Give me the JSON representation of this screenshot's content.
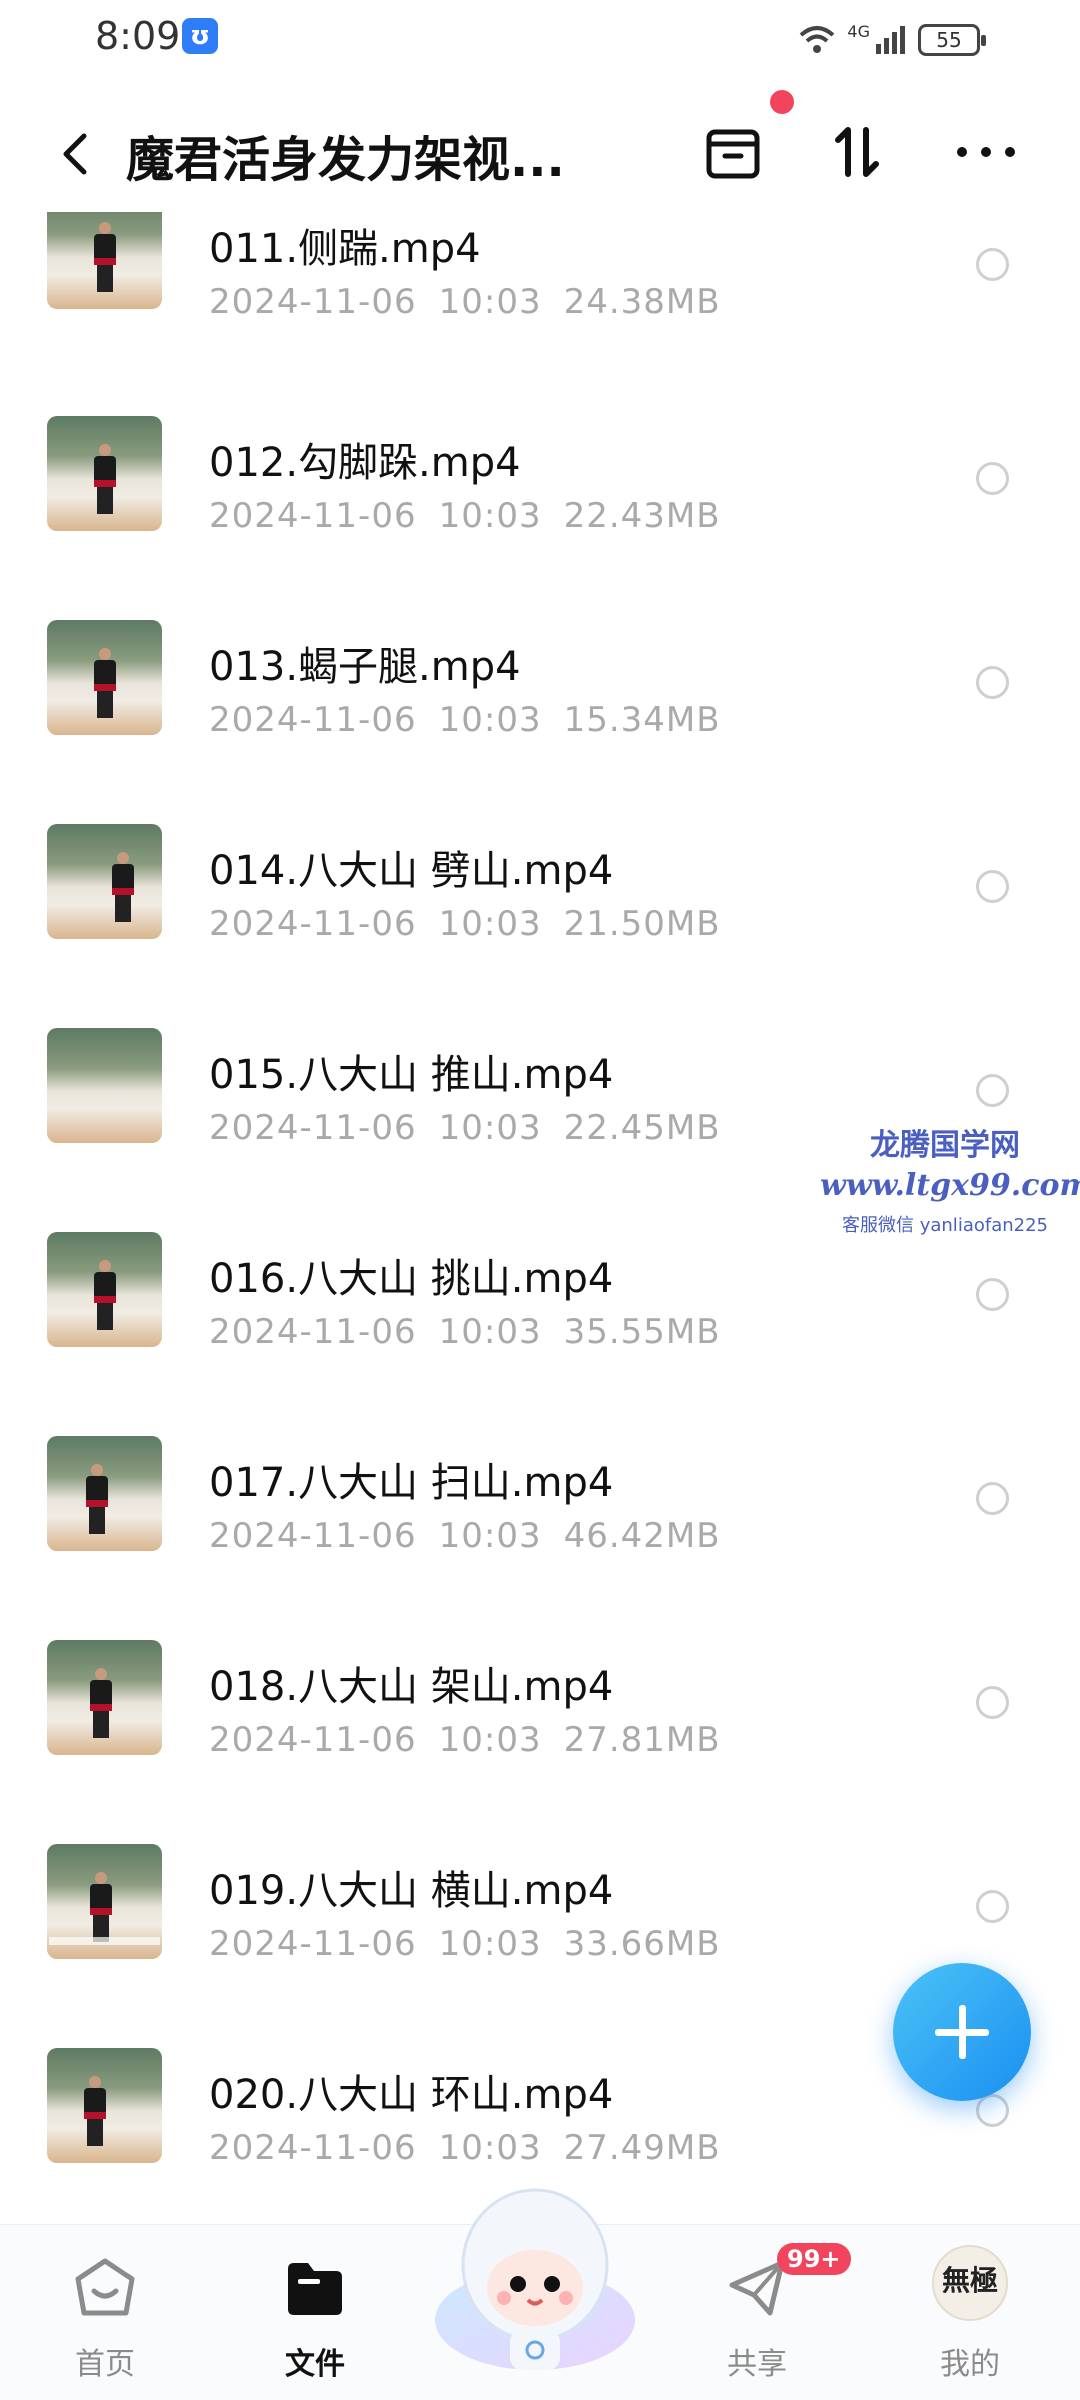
{
  "status_bar": {
    "time": "8:09",
    "network": "4G",
    "battery": "55"
  },
  "header": {
    "title": "魔君活身发力架视...",
    "back_icon": "chevron-left-icon",
    "archive_icon": "archive-box-icon",
    "sort_icon": "sort-arrows-icon",
    "more_icon": "more-dots-icon",
    "notification_dot_color": "#f2445c"
  },
  "files": [
    {
      "name": "011.侧踹.mp4",
      "date": "2024-11-06",
      "time": "10:03",
      "size": "24.38MB"
    },
    {
      "name": "012.勾脚跺.mp4",
      "date": "2024-11-06",
      "time": "10:03",
      "size": "22.43MB"
    },
    {
      "name": "013.蝎子腿.mp4",
      "date": "2024-11-06",
      "time": "10:03",
      "size": "15.34MB"
    },
    {
      "name": "014.八大山 劈山.mp4",
      "date": "2024-11-06",
      "time": "10:03",
      "size": "21.50MB"
    },
    {
      "name": "015.八大山 推山.mp4",
      "date": "2024-11-06",
      "time": "10:03",
      "size": "22.45MB"
    },
    {
      "name": "016.八大山 挑山.mp4",
      "date": "2024-11-06",
      "time": "10:03",
      "size": "35.55MB"
    },
    {
      "name": "017.八大山 扫山.mp4",
      "date": "2024-11-06",
      "time": "10:03",
      "size": "46.42MB"
    },
    {
      "name": "018.八大山 架山.mp4",
      "date": "2024-11-06",
      "time": "10:03",
      "size": "27.81MB"
    },
    {
      "name": "019.八大山 横山.mp4",
      "date": "2024-11-06",
      "time": "10:03",
      "size": "33.66MB"
    },
    {
      "name": "020.八大山 环山.mp4",
      "date": "2024-11-06",
      "time": "10:03",
      "size": "27.49MB"
    }
  ],
  "watermark": {
    "line1": "龙腾国学网",
    "line2": "www.ltgx99.com",
    "line3": "客服微信 yanliaofan225"
  },
  "fab": {
    "icon": "plus-icon",
    "color": "#1a8ff0"
  },
  "bottom_nav": {
    "home": {
      "label": "首页",
      "icon": "home-icon"
    },
    "files": {
      "label": "文件",
      "icon": "folder-icon"
    },
    "ai": {
      "icon": "mascot-icon"
    },
    "share": {
      "label": "共享",
      "icon": "paper-plane-icon",
      "badge": "99+"
    },
    "mine": {
      "label": "我的",
      "icon": "avatar-icon",
      "avatar_text": "無極"
    }
  }
}
